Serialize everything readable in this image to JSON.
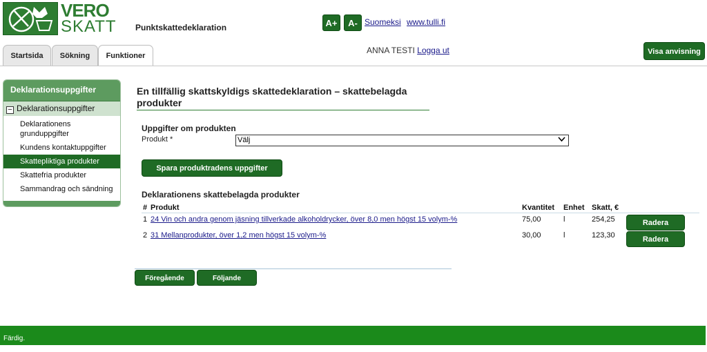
{
  "logo": {
    "line1": "VERO",
    "line2": "SKATT"
  },
  "app_title": "Punktskattedeklaration",
  "font_buttons": {
    "increase": "A+",
    "decrease": "A-"
  },
  "top_links": {
    "language": "Suomeksi",
    "customs": "www.tulli.fi"
  },
  "tabs": [
    {
      "label": "Startsida"
    },
    {
      "label": "Sökning"
    },
    {
      "label": "Funktioner"
    }
  ],
  "user": {
    "name": "ANNA TESTI",
    "logout": "Logga ut"
  },
  "help_button": "Visa anvisning",
  "sidebar": {
    "header": "Deklarationsuppgifter",
    "group": {
      "toggle": "−",
      "label": "Deklarationsuppgifter"
    },
    "items": [
      {
        "label": "Deklarationens grunduppgifter"
      },
      {
        "label": "Kundens kontaktuppgifter"
      },
      {
        "label": "Skattepliktiga produkter"
      },
      {
        "label": "Skattefria produkter"
      },
      {
        "label": "Sammandrag och sändning"
      }
    ]
  },
  "main": {
    "title": "En tillfällig skattskyldigs skattedeklaration – skattebelagda produkter",
    "section_products": "Uppgifter om produkten",
    "product_label": "Produkt *",
    "product_select_value": "Välj",
    "save_button": "Spara produktradens uppgifter",
    "section_declared": "Deklarationens skattebelagda produkter",
    "table": {
      "headers": {
        "num": "#",
        "product": "Produkt",
        "quantity": "Kvantitet",
        "unit": "Enhet",
        "tax": "Skatt, €"
      },
      "rows": [
        {
          "num": "1",
          "product": "24 Vin och andra genom jäsning tillverkade alkoholdrycker, över 8,0 men högst 15 volym-%",
          "quantity": "75,00",
          "unit": "l",
          "tax": "254,25",
          "action": "Radera"
        },
        {
          "num": "2",
          "product": "31 Mellanprodukter, över 1,2 men högst 15 volym-%",
          "quantity": "30,00",
          "unit": "l",
          "tax": "123,30",
          "action": "Radera"
        }
      ]
    },
    "prev_button": "Föregående",
    "next_button": "Följande"
  },
  "status": "Färdig.",
  "colors": {
    "brand_green": "#1f6b25",
    "status_green": "#1b8a1b",
    "sidebar_green": "#5d9b5f"
  }
}
